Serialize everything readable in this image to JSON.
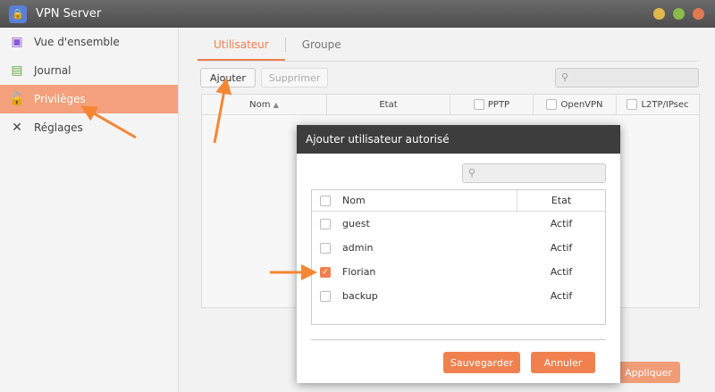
{
  "window": {
    "title": "VPN Server",
    "controls": {
      "minimize_color": "#e2b84b",
      "maximize_color": "#8bbb4a",
      "close_color": "#e07a52"
    }
  },
  "sidebar": {
    "items": [
      {
        "label": "Vue d'ensemble",
        "icon": "monitor-icon"
      },
      {
        "label": "Journal",
        "icon": "log-icon"
      },
      {
        "label": "Privilèges",
        "icon": "privileges-icon",
        "active": true
      },
      {
        "label": "Réglages",
        "icon": "tools-icon"
      }
    ]
  },
  "main": {
    "tabs": [
      {
        "label": "Utilisateur",
        "active": true
      },
      {
        "label": "Groupe"
      }
    ],
    "toolbar": {
      "add": "Ajouter",
      "delete": "Supprimer"
    },
    "columns": [
      "Nom",
      "Etat",
      "PPTP",
      "OpenVPN",
      "L2TP/IPsec"
    ],
    "apply": "Appliquer"
  },
  "dialog": {
    "title": "Ajouter utilisateur autorisé",
    "columns": [
      "Nom",
      "Etat"
    ],
    "rows": [
      {
        "name": "guest",
        "status": "Actif",
        "checked": false
      },
      {
        "name": "admin",
        "status": "Actif",
        "checked": false
      },
      {
        "name": "Florian",
        "status": "Actif",
        "checked": true
      },
      {
        "name": "backup",
        "status": "Actif",
        "checked": false
      }
    ],
    "save": "Sauvegarder",
    "cancel": "Annuler"
  },
  "accent": "#f0814f"
}
